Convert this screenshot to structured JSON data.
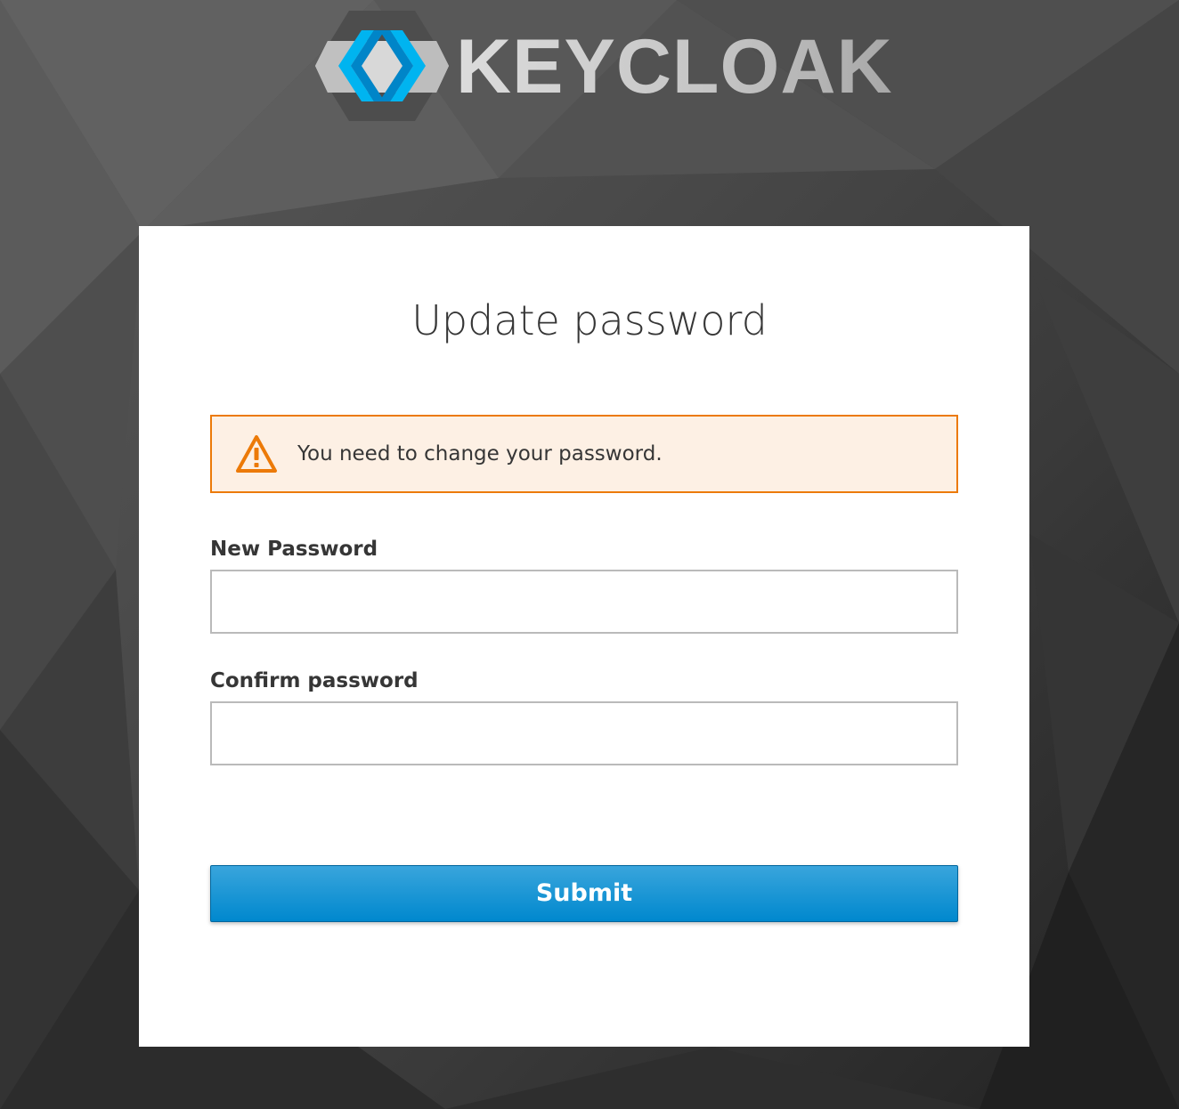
{
  "brand": {
    "name": "KEYCLOAK",
    "icon": "keycloak-logo-icon",
    "accent_color": "#00b4f0"
  },
  "form": {
    "title": "Update password",
    "alert": {
      "type": "warning",
      "icon": "warning-triangle-icon",
      "color": "#ec7a08",
      "message": "You need to change your password."
    },
    "new_password": {
      "label": "New Password",
      "value": ""
    },
    "confirm_password": {
      "label": "Confirm password",
      "value": ""
    },
    "submit_label": "Submit",
    "submit_color": "#0088ce"
  }
}
